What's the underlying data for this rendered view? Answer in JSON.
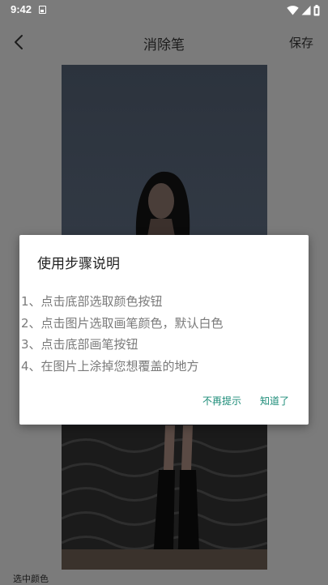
{
  "status_bar": {
    "time": "9:42"
  },
  "toolbar": {
    "title": "消除笔",
    "save_label": "保存"
  },
  "bottom": {
    "selected_color_label": "选中颜色"
  },
  "dialog": {
    "title": "使用步骤说明",
    "steps": [
      "1、点击底部选取颜色按钮",
      "2、点击图片选取画笔颜色，默认白色",
      "3、点击底部画笔按钮",
      "4、在图片上涂掉您想覆盖的地方"
    ],
    "no_remind_label": "不再提示",
    "got_it_label": "知道了",
    "button_color": "#1c8c78"
  },
  "icons": {
    "back": "chevron-left-icon",
    "wifi": "wifi-icon",
    "signal": "signal-icon",
    "battery": "battery-icon",
    "notification": "notification-icon"
  }
}
